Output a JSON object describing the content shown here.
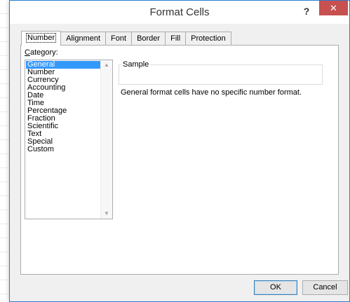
{
  "window": {
    "title": "Format Cells",
    "help_label": "?",
    "close_label": "✕",
    "accent_color": "#c75050"
  },
  "tabs": [
    {
      "label": "Number",
      "active": true
    },
    {
      "label": "Alignment",
      "active": false
    },
    {
      "label": "Font",
      "active": false
    },
    {
      "label": "Border",
      "active": false
    },
    {
      "label": "Fill",
      "active": false
    },
    {
      "label": "Protection",
      "active": false
    }
  ],
  "category": {
    "label_underlined": "C",
    "label_rest": "ategory:",
    "items": [
      "General",
      "Number",
      "Currency",
      "Accounting",
      "Date",
      "Time",
      "Percentage",
      "Fraction",
      "Scientific",
      "Text",
      "Special",
      "Custom"
    ],
    "selected": "General",
    "selection_color": "#3399ff"
  },
  "sample": {
    "legend": "Sample",
    "value": ""
  },
  "description": "General format cells have no specific number format.",
  "buttons": {
    "ok": "OK",
    "cancel": "Cancel"
  }
}
